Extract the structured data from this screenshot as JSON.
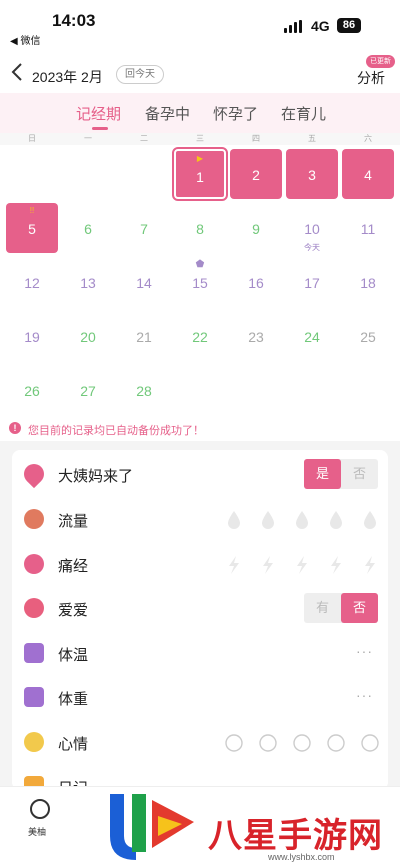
{
  "status_bar": {
    "time": "14:03",
    "back_app": "◀ 微信",
    "network": "4G",
    "battery": "86"
  },
  "header": {
    "month": "2023年 2月",
    "today_button": "回今天",
    "analysis": "分析",
    "analysis_badge": "已更新"
  },
  "tabs": [
    {
      "label": "记经期",
      "active": true
    },
    {
      "label": "备孕中",
      "active": false
    },
    {
      "label": "怀孕了",
      "active": false
    },
    {
      "label": "在育儿",
      "active": false
    }
  ],
  "weekdays": [
    "日",
    "一",
    "二",
    "三",
    "四",
    "五",
    "六"
  ],
  "calendar_days": [
    {
      "num": "1",
      "state": "period-start",
      "mark": "▶"
    },
    {
      "num": "2",
      "state": "period"
    },
    {
      "num": "3",
      "state": "period"
    },
    {
      "num": "4",
      "state": "period"
    },
    {
      "num": "5",
      "state": "period",
      "mark": "!!"
    },
    {
      "num": "6",
      "state": "safe"
    },
    {
      "num": "7",
      "state": "safe"
    },
    {
      "num": "8",
      "state": "safe"
    },
    {
      "num": "9",
      "state": "safe"
    },
    {
      "num": "10",
      "state": "fertile",
      "sub": "今天"
    },
    {
      "num": "11",
      "state": "fertile"
    },
    {
      "num": "12",
      "state": "fertile"
    },
    {
      "num": "13",
      "state": "fertile"
    },
    {
      "num": "14",
      "state": "fertile"
    },
    {
      "num": "15",
      "state": "fertile",
      "mark": "⬟"
    },
    {
      "num": "16",
      "state": "fertile"
    },
    {
      "num": "17",
      "state": "fertile"
    },
    {
      "num": "18",
      "state": "fertile"
    },
    {
      "num": "19",
      "state": "fertile"
    },
    {
      "num": "20",
      "state": "safe"
    },
    {
      "num": "21",
      "state": "normal"
    },
    {
      "num": "22",
      "state": "safe"
    },
    {
      "num": "23",
      "state": "normal"
    },
    {
      "num": "24",
      "state": "safe"
    },
    {
      "num": "25",
      "state": "normal"
    },
    {
      "num": "26",
      "state": "safe"
    },
    {
      "num": "27",
      "state": "safe"
    },
    {
      "num": "28",
      "state": "safe"
    }
  ],
  "notice": "您目前的记录均已自动备份成功了！",
  "records": {
    "period": {
      "label": "大姨妈来了",
      "yes": "是",
      "no": "否",
      "selected": "yes"
    },
    "flow": {
      "label": "流量"
    },
    "pain": {
      "label": "痛经"
    },
    "love": {
      "label": "爱爱",
      "yes": "有",
      "no": "否",
      "selected": "no"
    },
    "temperature": {
      "label": "体温",
      "more": "···"
    },
    "weight": {
      "label": "体重",
      "more": "···"
    },
    "mood": {
      "label": "心情"
    },
    "diary": {
      "label": "日记"
    }
  },
  "bottom_nav": {
    "first_tab": "美柚"
  },
  "watermark": {
    "text": "八星手游网",
    "url": "www.lyshbx.com"
  },
  "colors": {
    "accent": "#e6608a",
    "safe": "#71c87a",
    "fertile": "#a48bc9"
  }
}
